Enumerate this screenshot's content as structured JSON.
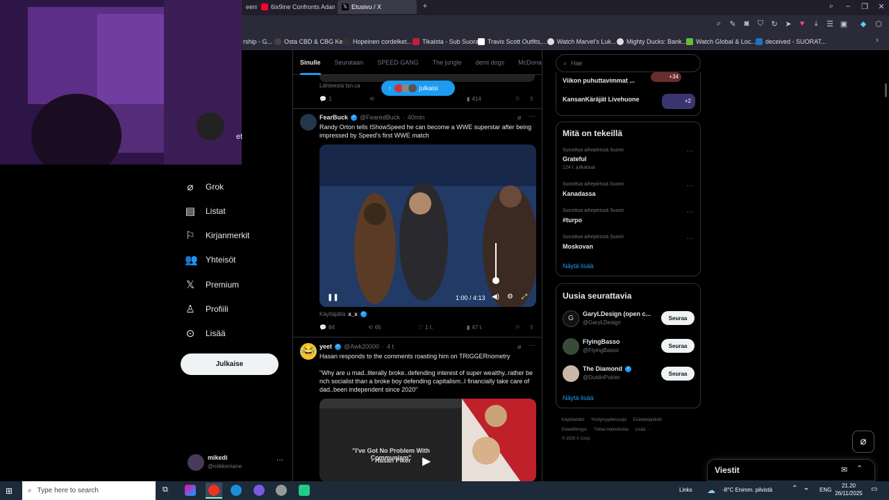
{
  "browser": {
    "tabs": [
      {
        "label": "eeni",
        "color": "#ff0033"
      },
      {
        "label": "6ix9ine Confronts Adam22",
        "color": "#ff0033"
      },
      {
        "label": "Etusivu / X",
        "color": "#ffffff"
      }
    ],
    "bookmarks": [
      {
        "label": "rship - G...",
        "color": "#888888"
      },
      {
        "label": "Osta CBD & CBG Ke...",
        "color": "#444444"
      },
      {
        "label": "Hopeinen cordelket...",
        "color": "#333333"
      },
      {
        "label": "Tikaista - Sub Suora",
        "color": "#c41e3a"
      },
      {
        "label": "Travis Scott Outfits,...",
        "color": "#ffffff"
      },
      {
        "label": "Watch Marvel's Luk...",
        "color": "#dddddd"
      },
      {
        "label": "Mighty Ducks: Bank...",
        "color": "#dddddd"
      },
      {
        "label": "Watch Global & Loc...",
        "color": "#5fbf3f"
      },
      {
        "label": "deceived - SUORAT...",
        "color": "#1e73be"
      }
    ]
  },
  "nav": {
    "items": [
      {
        "label": "Grok",
        "icon": "grok-icon"
      },
      {
        "label": "Listat",
        "icon": "list-icon"
      },
      {
        "label": "Kirjanmerkit",
        "icon": "bookmark-icon"
      },
      {
        "label": "Yhteisöt",
        "icon": "communities-icon"
      },
      {
        "label": "Premium",
        "icon": "x-logo-icon"
      },
      {
        "label": "Profiili",
        "icon": "person-icon"
      },
      {
        "label": "Lisää",
        "icon": "more-circle-icon"
      }
    ],
    "post_label": "Julkaise",
    "partial_label": "et",
    "account": {
      "name": "mikedi",
      "handle": "@mikkemane"
    }
  },
  "feed": {
    "tabs": [
      "Sinulle",
      "Seurataan",
      "SPEED GANG",
      "The jungle",
      "demi dogs",
      "McDonalds"
    ],
    "pill_label": "julkaisi",
    "prev_tweet": {
      "source": "Lähteestä tsn.ca",
      "replies": "1",
      "views": "414"
    },
    "tweet1": {
      "name": "FearBuck",
      "handle": "@FearedBuck",
      "time": "40min",
      "text": "Randy Orton tells IShowSpeed he can become a WWE superstar after being impressed by Speed's first WWE match",
      "video_time": "1:00 / 4:13",
      "attribution_prefix": "Käyttäjältä",
      "attribution_user": "x_x",
      "replies": "84",
      "reposts": "65",
      "likes": "1 t.",
      "views": "47 t."
    },
    "tweet2": {
      "name": "yeet",
      "handle": "@Awk20000",
      "time": "4 t",
      "text": "Hasan responds to the comments roasting him on TRIGGERnometry",
      "quote": "\"Why are u mad..literally broke..defending interest of super wealthy..rather be rich socialist than a broke boy defending capitalism..I financially take care of dad..been independent since 2020\"",
      "thumb_caption": "\"I've Got No Problem With Communism\"",
      "thumb_sub": "- Hasan Piker"
    }
  },
  "right": {
    "search_placeholder": "Hae",
    "top_items": [
      {
        "label": "Viikon puhuttavimmat ...",
        "badge": "+34"
      },
      {
        "label": "KansanKäräjät Livehuone",
        "badge": "+2"
      }
    ],
    "trends_title": "Mitä on tekeillä",
    "trends": [
      {
        "context": "Suosittua aihepiirissä Suomi",
        "name": "Grateful",
        "count": "124 t. julkaisua"
      },
      {
        "context": "Suosittua aihepiirissä Suomi",
        "name": "Kanadassa",
        "count": ""
      },
      {
        "context": "Suosittua aihepiirissä Suomi",
        "name": "#turpo",
        "count": ""
      },
      {
        "context": "Suosittua aihepiirissä Suomi",
        "name": "Moskovan",
        "count": ""
      }
    ],
    "show_more": "Näytä lisää",
    "who_title": "Uusia seurattavia",
    "who": [
      {
        "name": "GaryLDesign (open c...",
        "handle": "@GaryLDesign",
        "button": "Seuraa"
      },
      {
        "name": "FlyingBasso",
        "handle": "@FlyingBasso",
        "button": "Seuraa"
      },
      {
        "name": "The Diamond",
        "handle": "@DustinPoirier",
        "button": "Seuraa"
      }
    ],
    "footer1": [
      "Käyttöehdot",
      "Yksityisyydensuoja",
      "Evästekäytäntö"
    ],
    "footer2": [
      "Esteettömyys",
      "Tietoa mainoksista",
      "Lisää ···"
    ],
    "copyright": "© 2025 X Corp.",
    "messages_title": "Viestit"
  },
  "taskbar": {
    "search_placeholder": "Type here to search",
    "links": "Links",
    "weather": "-8°C  Enimm. pilvistä",
    "lang": "ENG",
    "time": "21.20",
    "date": "26/11/2025"
  }
}
